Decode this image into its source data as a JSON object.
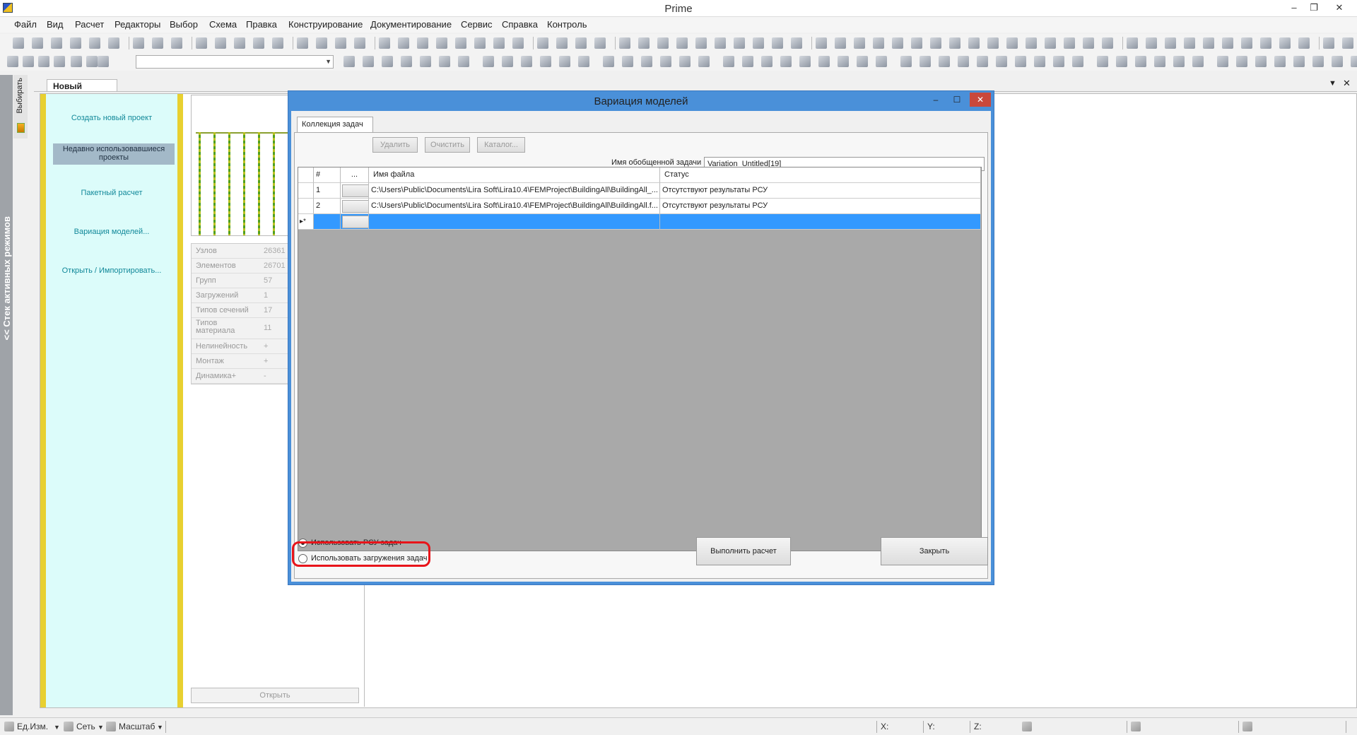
{
  "window": {
    "title": "Prime",
    "minimize": "–",
    "maximize": "❐",
    "close": "✕"
  },
  "menu": [
    "Файл",
    "Вид",
    "Расчет",
    "Редакторы",
    "Выбор",
    "Схема",
    "Правка",
    "Конструирование",
    "Документирование",
    "Сервис",
    "Справка",
    "Контроль"
  ],
  "left_rail": {
    "stack_label": "<< Стек активных режимов",
    "select_label": "Выбирать"
  },
  "doc_tab": "Новый проект",
  "start_nav": {
    "create": "Создать новый проект",
    "recent": "Недавно использовавшиеся проекты",
    "batch": "Пакетный расчет",
    "variation": "Вариация моделей...",
    "open_import": "Открыть / Импортировать..."
  },
  "props": [
    {
      "k": "Узлов",
      "v": "26361"
    },
    {
      "k": "Элементов",
      "v": "26701"
    },
    {
      "k": "Групп",
      "v": "57"
    },
    {
      "k": "Загружений",
      "v": "1"
    },
    {
      "k": "Типов сечений",
      "v": "17"
    },
    {
      "k": "Типов материала",
      "v": "11"
    },
    {
      "k": "Нелинейность",
      "v": "+"
    },
    {
      "k": "Монтаж",
      "v": "+"
    },
    {
      "k": "Динамика+",
      "v": "-"
    }
  ],
  "open_button": "Открыть",
  "dialog": {
    "title": "Вариация моделей",
    "tab": "Коллекция задач",
    "btn_delete": "Удалить",
    "btn_clear": "Очистить",
    "btn_catalog": "Каталог...",
    "generic_label": "Имя обобщенной задачи",
    "generic_value": "Variation_Untitled[19]",
    "columns": {
      "num": "#",
      "dots": "...",
      "file": "Имя файла",
      "status": "Статус"
    },
    "rows": [
      {
        "num": "1",
        "file": "C:\\Users\\Public\\Documents\\Lira Soft\\Lira10.4\\FEMProject\\BuildingAll\\BuildingAll_...",
        "status": "Отсутствуют результаты РСУ"
      },
      {
        "num": "2",
        "file": "C:\\Users\\Public\\Documents\\Lira Soft\\Lira10.4\\FEMProject\\BuildingAll\\BuildingAll.f...",
        "status": "Отсутствуют результаты РСУ"
      }
    ],
    "new_row_marker": "▸*",
    "radio_rsu": "Использовать РСУ задач",
    "radio_loads": "Использовать загружения задач",
    "run": "Выполнить расчет",
    "close": "Закрыть"
  },
  "status": {
    "units": "Ед.Изм.",
    "grid": "Сеть",
    "scale": "Масштаб",
    "x": "X:",
    "y": "Y:",
    "z": "Z:"
  }
}
